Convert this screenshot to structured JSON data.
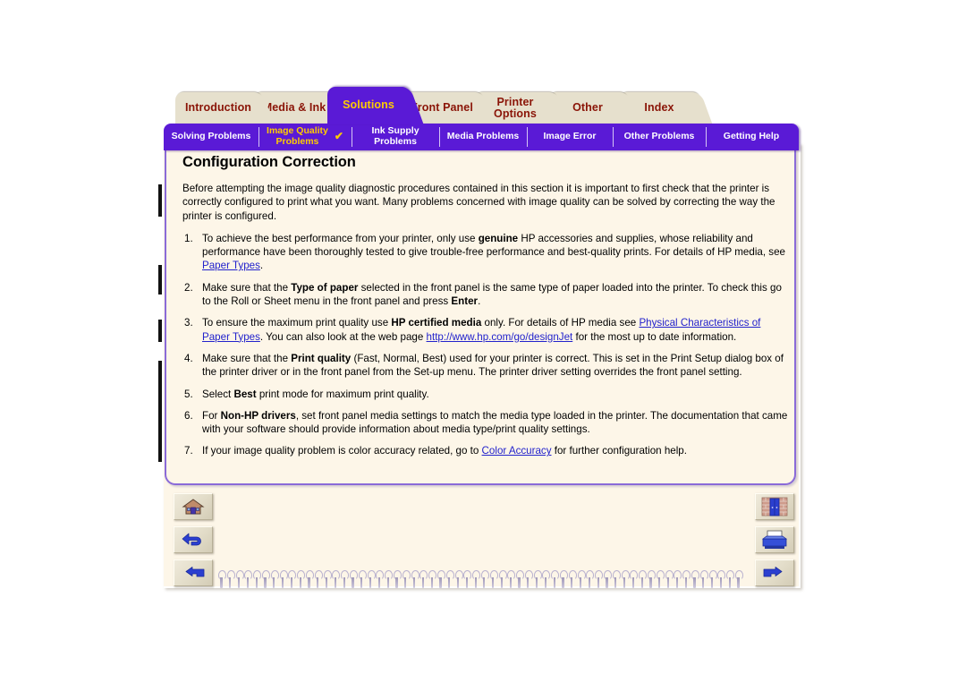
{
  "doc": {
    "title": "Configuration Correction"
  },
  "tabs": [
    {
      "label": "Introduction",
      "key": "introduction",
      "active": false
    },
    {
      "label": "Media & Ink",
      "key": "media-and-ink",
      "active": false
    },
    {
      "label": "Solutions",
      "key": "solutions",
      "active": true
    },
    {
      "label": "Front Panel",
      "key": "front-panel",
      "active": false
    },
    {
      "label": "Printer Options",
      "key": "printer-options",
      "active": false,
      "line1": "Printer",
      "line2": "Options"
    },
    {
      "label": "Other",
      "key": "other",
      "active": false
    },
    {
      "label": "Index",
      "key": "index",
      "active": false
    }
  ],
  "subtabs": [
    {
      "label": "Solving Problems",
      "key": "solving-problems",
      "current": false,
      "check": ""
    },
    {
      "line1": "Image Quality",
      "line2": "Problems",
      "label": "Image Quality Problems",
      "key": "image-quality-problems",
      "current": true,
      "check": "✔"
    },
    {
      "line1": "Ink Supply",
      "line2": "Problems",
      "label": "Ink Supply Problems",
      "key": "ink-supply-problems",
      "current": false,
      "check": ""
    },
    {
      "label": "Media Problems",
      "key": "media-problems",
      "current": false,
      "check": ""
    },
    {
      "label": "Image Error",
      "key": "image-error",
      "current": false,
      "check": ""
    },
    {
      "label": "Other Problems",
      "key": "other-problems",
      "current": false,
      "check": ""
    },
    {
      "label": "Getting Help",
      "key": "getting-help",
      "current": false,
      "check": ""
    }
  ],
  "intro": "Before attempting the image quality diagnostic procedures contained in this section it is important to first check that the printer is correctly configured to print what you want. Many problems concerned with image quality can be solved by correcting the way the printer is configured.",
  "steps": {
    "s1": {
      "p1": "To achieve the best performance from your printer, only use ",
      "b1": "genuine",
      "p2": " HP accessories and supplies, whose reliability and performance have been thoroughly tested to give trouble-free performance and best-quality prints. For details of HP media, see ",
      "link1": "Paper Types",
      "p3": "."
    },
    "s2": {
      "p1": "Make sure that the ",
      "b1": "Type of paper",
      "p2": " selected in the front panel is the same type of paper loaded into the printer. To check this go to the Roll or Sheet menu in the front panel and press ",
      "b2": "Enter",
      "p3": "."
    },
    "s3": {
      "p1": "To ensure the maximum print quality use ",
      "b1": "HP certified media",
      "p2": " only. For details of HP media see ",
      "link1": "Physical Characteristics of Paper Types",
      "p3": ". You can also look at the web page ",
      "link2": "http://www.hp.com/go/designJet",
      "p4": " for the most up to date information."
    },
    "s4": {
      "p1": "Make sure that the ",
      "b1": "Print quality",
      "p2": " (Fast, Normal, Best) used for your printer is correct. This is set in the Print Setup dialog box of the printer driver or in the front panel from the Set-up menu. The printer driver setting overrides the front panel setting."
    },
    "s5": {
      "p1": "Select ",
      "b1": "Best",
      "p2": " print mode for maximum print quality."
    },
    "s6": {
      "p1": "For ",
      "b1": "Non-HP drivers",
      "p2": ", set front panel media settings to match the media type loaded in the printer. The documentation that came with your software should provide information about media type/print quality settings."
    },
    "s7": {
      "p1": "If your image quality problem is color accuracy related, go to ",
      "link1": "Color Accuracy",
      "p2": " for further configuration help."
    }
  },
  "nav": {
    "left": [
      {
        "key": "home",
        "icon": "home-icon",
        "label": "Home"
      },
      {
        "key": "back",
        "icon": "back-arrow-icon",
        "label": "Back"
      },
      {
        "key": "previous",
        "icon": "hand-pointing-left-icon",
        "label": "Previous page"
      }
    ],
    "right": [
      {
        "key": "exit",
        "icon": "exit-door-icon",
        "label": "Exit"
      },
      {
        "key": "print",
        "icon": "printer-icon",
        "label": "Print"
      },
      {
        "key": "next",
        "icon": "hand-pointing-right-icon",
        "label": "Next page"
      }
    ]
  },
  "colors": {
    "accent_purple": "#5a1ad6",
    "tab_beige": "#e6e0cd",
    "tab_text_maroon": "#8a1407",
    "active_tab_text": "#ffcc00",
    "page_cream": "#fdf6e8",
    "link_blue": "#2222cc",
    "panel_border": "#8a6ad8"
  }
}
